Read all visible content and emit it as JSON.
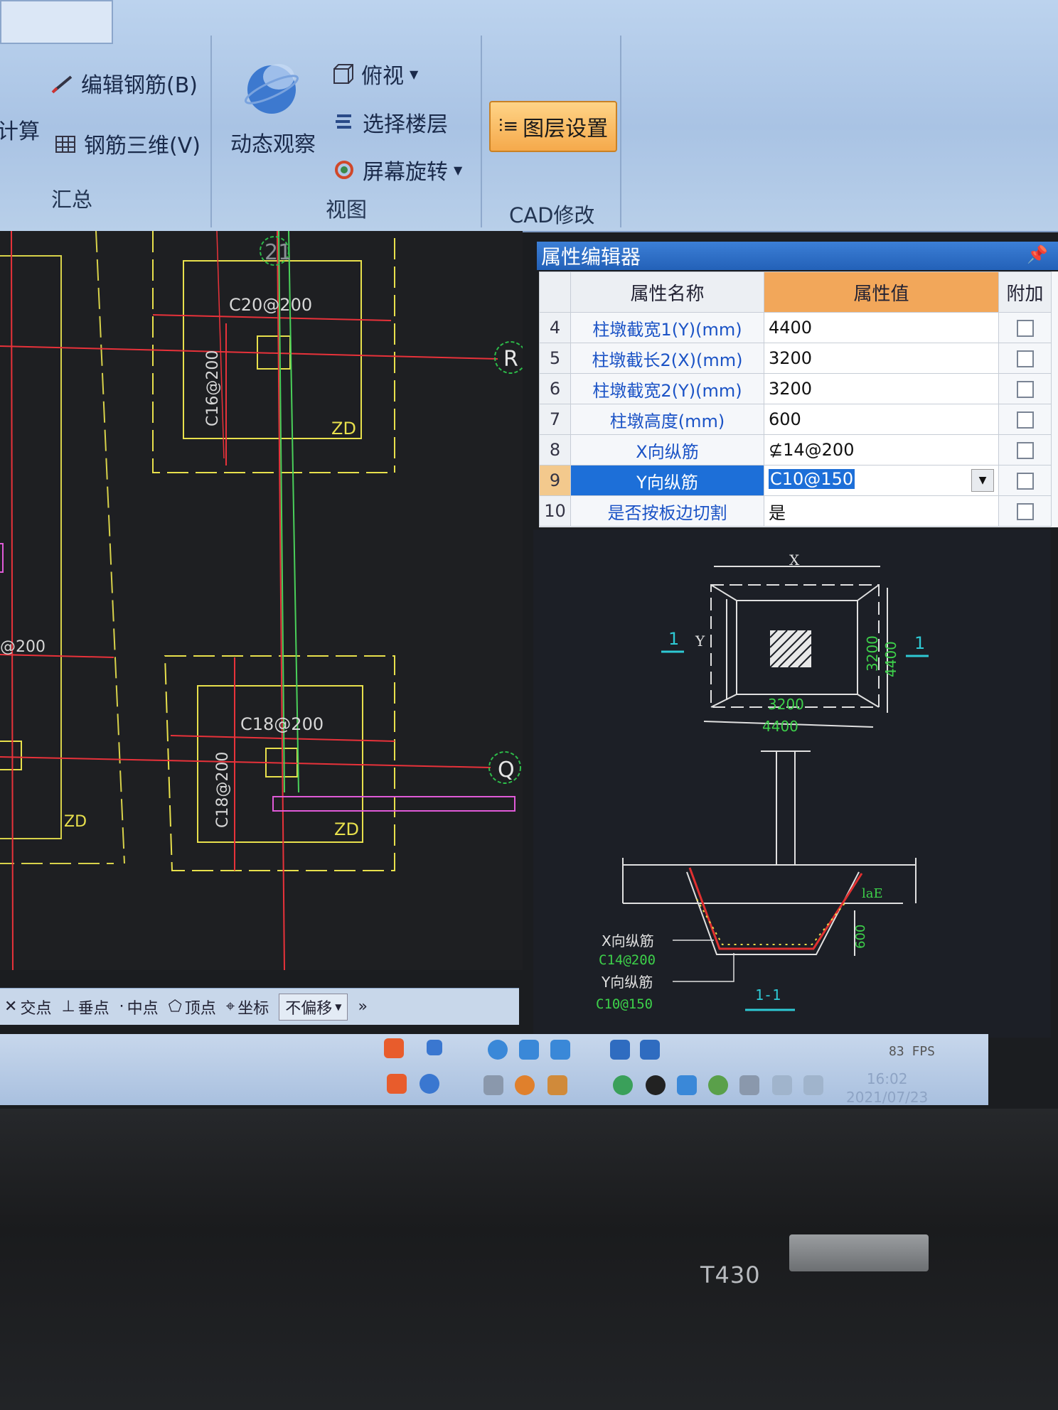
{
  "ribbon": {
    "left_cut": "计算",
    "edit_rebar": "编辑钢筋(B)",
    "rebar_3d": "钢筋三维(V)",
    "group_summary": "汇总",
    "dynamic_view": "动态观察",
    "top_view": "俯视",
    "select_floor": "选择楼层",
    "screen_rotate": "屏幕旋转",
    "group_view": "视图",
    "layer_settings": "图层设置",
    "group_cad": "CAD修改"
  },
  "cad": {
    "axis_21": "21",
    "axis_R": "R",
    "axis_Q": "Q",
    "label_c20": "C20@200",
    "label_c16": "C16@200",
    "label_zd1": "ZD",
    "label_left_200": "@200",
    "label_zd_left": "ZD",
    "label_c18_h": "C18@200",
    "label_c18_v": "C18@200",
    "label_zd2": "ZD"
  },
  "snapbar": {
    "intersection": "交点",
    "perpendicular": "垂点",
    "midpoint": "中点",
    "vertex": "顶点",
    "coordinate": "坐标",
    "offset": "不偏移",
    "more": "»"
  },
  "prop_editor": {
    "title": "属性编辑器",
    "col_name": "属性名称",
    "col_value": "属性值",
    "col_extra": "附加",
    "rows": [
      {
        "idx": "4",
        "name": "柱墩截宽1(Y)(mm)",
        "value": "4400"
      },
      {
        "idx": "5",
        "name": "柱墩截长2(X)(mm)",
        "value": "3200"
      },
      {
        "idx": "6",
        "name": "柱墩截宽2(Y)(mm)",
        "value": "3200"
      },
      {
        "idx": "7",
        "name": "柱墩高度(mm)",
        "value": "600"
      },
      {
        "idx": "8",
        "name": "X向纵筋",
        "value": "⊈14@200"
      },
      {
        "idx": "9",
        "name": "Y向纵筋",
        "value": "C10@150"
      },
      {
        "idx": "10",
        "name": "是否按板边切割",
        "value": "是"
      }
    ]
  },
  "preview": {
    "dim_x": "X",
    "dim_y": "Y",
    "section_left": "1",
    "section_right": "1",
    "dim_3200_v": "3200",
    "dim_4400_v": "4400",
    "dim_3200_h": "3200",
    "dim_4400_h": "4400",
    "lae": "laE",
    "dim_600": "600",
    "x_rebar_label": "X向纵筋",
    "x_rebar_value": "C14@200",
    "y_rebar_label": "Y向纵筋",
    "y_rebar_value": "C10@150",
    "section_name": "1-1"
  },
  "status": {
    "fps": "83 FPS",
    "time": "16:02",
    "date": "2021/07/23"
  },
  "device": {
    "model": "T430"
  }
}
